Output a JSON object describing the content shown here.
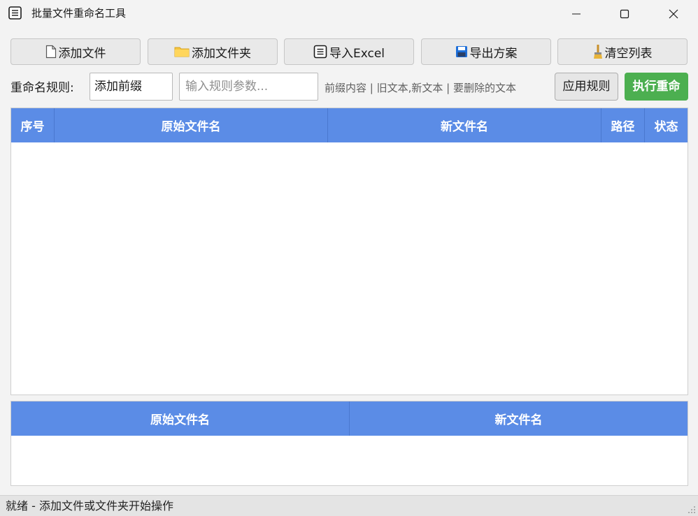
{
  "window": {
    "title": "批量文件重命名工具",
    "icon": "list-icon"
  },
  "toolbar": {
    "add_file": {
      "label": "添加文件",
      "icon": "file-icon"
    },
    "add_folder": {
      "label": "添加文件夹",
      "icon": "folder-icon"
    },
    "import_excel": {
      "label": "导入Excel",
      "icon": "list-icon"
    },
    "export_scheme": {
      "label": "导出方案",
      "icon": "floppy-disk-icon"
    },
    "clear_list": {
      "label": "清空列表",
      "icon": "broom-icon"
    }
  },
  "rule_bar": {
    "label": "重命名规则:",
    "rule_selected": "添加前缀",
    "param_placeholder": "输入规则参数...",
    "hint": "前缀内容 | 旧文本,新文本 | 要删除的文本",
    "apply_label": "应用规则",
    "execute_label": "执行重命"
  },
  "main_table": {
    "columns": [
      "序号",
      "原始文件名",
      "新文件名",
      "路径",
      "状态"
    ],
    "rows": []
  },
  "preview_table": {
    "columns": [
      "原始文件名",
      "新文件名"
    ],
    "rows": []
  },
  "status": {
    "text": "就绪 - 添加文件或文件夹开始操作"
  },
  "colors": {
    "header_blue": "#5b8ce6",
    "execute_green": "#4caf50",
    "folder_yellow": "#f5c542",
    "floppy_blue": "#1e6fd9"
  }
}
